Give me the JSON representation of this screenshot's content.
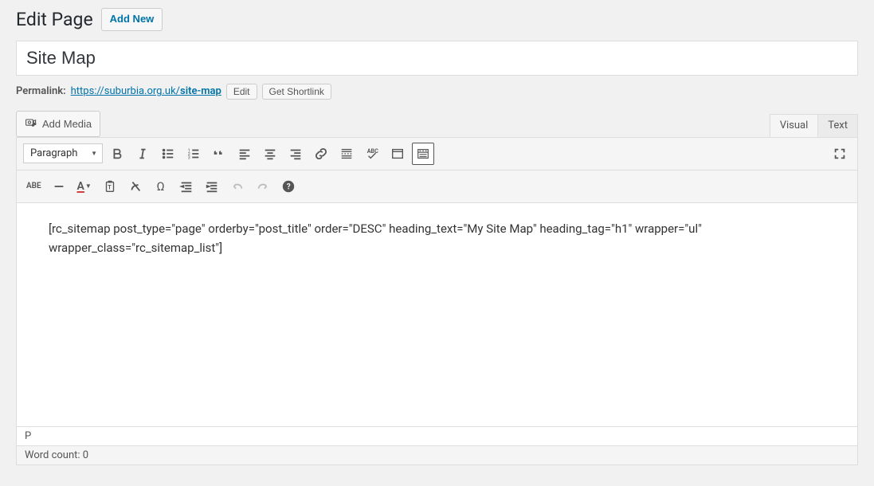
{
  "header": {
    "title": "Edit Page",
    "add_new_label": "Add New"
  },
  "post": {
    "title_value": "Site Map"
  },
  "permalink": {
    "label": "Permalink:",
    "base_url": "https://suburbia.org.uk/",
    "slug": "site-map",
    "edit_label": "Edit",
    "shortlink_label": "Get Shortlink"
  },
  "media": {
    "add_media_label": "Add Media"
  },
  "tabs": {
    "visual": "Visual",
    "text": "Text"
  },
  "toolbar": {
    "format_selected": "Paragraph"
  },
  "editor": {
    "content": "[rc_sitemap post_type=\"page\" orderby=\"post_title\" order=\"DESC\" heading_text=\"My Site Map\" heading_tag=\"h1\" wrapper=\"ul\" wrapper_class=\"rc_sitemap_list\"]",
    "path": "P"
  },
  "footer": {
    "word_count_label": "Word count:",
    "word_count_value": "0"
  }
}
